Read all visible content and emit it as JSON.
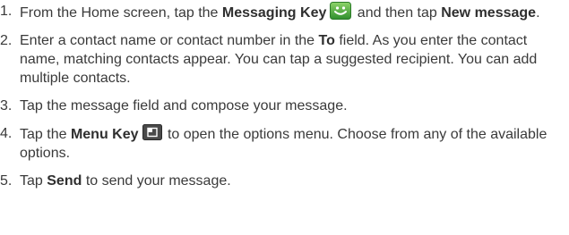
{
  "steps": [
    {
      "num": "1.",
      "t1": "From the Home screen, tap the ",
      "messaging_key": "Messaging Key",
      "t2": " and then tap ",
      "new_message": "New message",
      "t3": "."
    },
    {
      "num": "2.",
      "t1": "Enter a contact name or contact number in the ",
      "to_field": "To",
      "t2": " field. As you enter the contact name, matching contacts appear. You can tap a suggested recipient. You can add multiple contacts."
    },
    {
      "num": "3.",
      "text": "Tap the message field and compose your message."
    },
    {
      "num": "4.",
      "t1": "Tap the ",
      "menu_key": "Menu Key",
      "t2": " to open the options menu. Choose from any of the available options."
    },
    {
      "num": "5.",
      "t1": "Tap ",
      "send": "Send",
      "t2": " to send your message."
    }
  ],
  "icons": {
    "messaging_key_icon": "smiley-message-icon",
    "menu_key_icon": "menu-key-icon"
  },
  "colors": {
    "text": "#3a3a3a",
    "messaging_icon_green": "#3fa33a"
  }
}
